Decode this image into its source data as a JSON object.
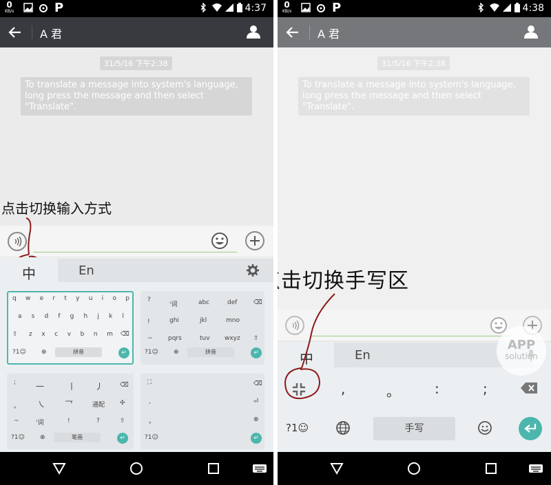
{
  "left": {
    "status": {
      "kb_top": "0",
      "kb_bottom": "KB/s",
      "p": "P",
      "time": "4:37"
    },
    "appbar": {
      "title": "A 君"
    },
    "chat": {
      "timestamp": "31/5/16 下午2:38",
      "system_message": "To translate a message into system's language, long press the message and then select \"Translate\"."
    },
    "annotation": "点击切换输入方式",
    "ime": {
      "zh": "中",
      "en": "En"
    },
    "layouts": {
      "qwerty": {
        "row1": [
          "q",
          "w",
          "e",
          "r",
          "t",
          "y",
          "u",
          "i",
          "o",
          "p"
        ],
        "row2": [
          "a",
          "s",
          "d",
          "f",
          "g",
          "h",
          "j",
          "k",
          "l"
        ],
        "row3": [
          "z",
          "x",
          "c",
          "v",
          "b",
          "n",
          "m"
        ],
        "left_key": "?1☺",
        "space": "拼音"
      },
      "t9": {
        "row1": [
          "'词",
          "abc",
          "def"
        ],
        "row2": [
          "ghi",
          "jkl",
          "mno"
        ],
        "row3": [
          "pqrs",
          "tuv",
          "wxyz"
        ],
        "side": [
          "?",
          "!",
          "~"
        ],
        "left_key": "?1☺",
        "space": "拼音"
      },
      "stroke": {
        "row1": [
          "一",
          "丨",
          "丿"
        ],
        "row2": [
          "㇏",
          "乛",
          "通配"
        ],
        "row3": [
          "'词",
          "!",
          "?"
        ],
        "side": [
          ";",
          "。",
          "~"
        ],
        "left_key": "?1☺",
        "space": "笔画"
      },
      "handwrite": {
        "side": [
          ",",
          "。"
        ],
        "left_key": "?1☺"
      }
    }
  },
  "right": {
    "status": {
      "kb_top": "0",
      "kb_bottom": "KB/s",
      "p": "P",
      "time": "4:38"
    },
    "appbar": {
      "title": "A 君"
    },
    "chat": {
      "timestamp": "31/5/16 下午2:38",
      "system_message": "To translate a message into system's language, long press the message and then select \"Translate\"."
    },
    "annotation": "点击切换手写区",
    "ime": {
      "zh": "中",
      "en": "En"
    },
    "punct": [
      ",",
      "。",
      ":",
      ";"
    ],
    "bottom": {
      "left_key": "?1☺",
      "space": "手写"
    },
    "watermark": {
      "line1": "APP",
      "line2": "solution"
    }
  },
  "colors": {
    "appbar": "#393a3f",
    "accent": "#4db6ac",
    "annotation_ink": "#8b1a1a"
  }
}
